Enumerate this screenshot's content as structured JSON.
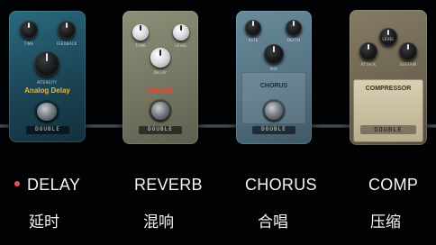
{
  "pedals": [
    {
      "id": "delay",
      "name": "DELAY",
      "name_cn": "延时",
      "selected": true,
      "color": "#1f4a5c",
      "knob_labels": [
        "TIME",
        "FEEDBACK",
        "INTENSITY"
      ],
      "title": "Analog Delay",
      "plate": "DOUBLE"
    },
    {
      "id": "reverb",
      "name": "REVERB",
      "name_cn": "混响",
      "selected": false,
      "color": "#7a7c66",
      "knob_labels": [
        "TONE",
        "DECAY",
        "LEVEL"
      ],
      "title": "REVERB",
      "plate": "DOUBLE"
    },
    {
      "id": "chorus",
      "name": "CHORUS",
      "name_cn": "合唱",
      "selected": false,
      "color": "#5a7a8a",
      "knob_labels": [
        "RATE",
        "DEPTH",
        "MIX"
      ],
      "title": "CHORUS",
      "plate": "DOUBLE"
    },
    {
      "id": "comp",
      "name": "COMP",
      "name_cn": "压缩",
      "selected": false,
      "color": "#706752",
      "knob_labels": [
        "LEVEL",
        "ATTACK",
        "SUSTAIN"
      ],
      "title": "COMPRESSOR",
      "plate": "DOUBLE"
    }
  ],
  "accent_color": "#e94b6a"
}
